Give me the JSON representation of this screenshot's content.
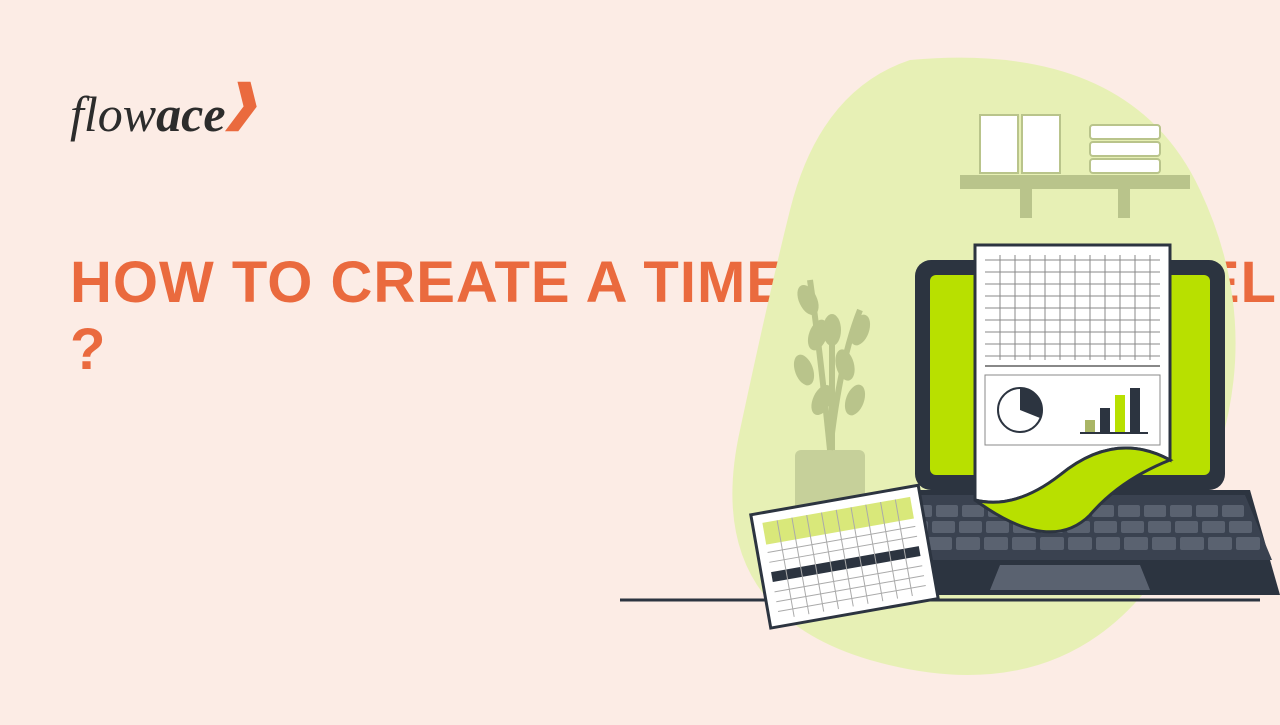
{
  "logo": {
    "part1": "flow",
    "part2": "ace"
  },
  "headline": "HOW TO CREATE A TIMESHEET IN EXCEL ?"
}
